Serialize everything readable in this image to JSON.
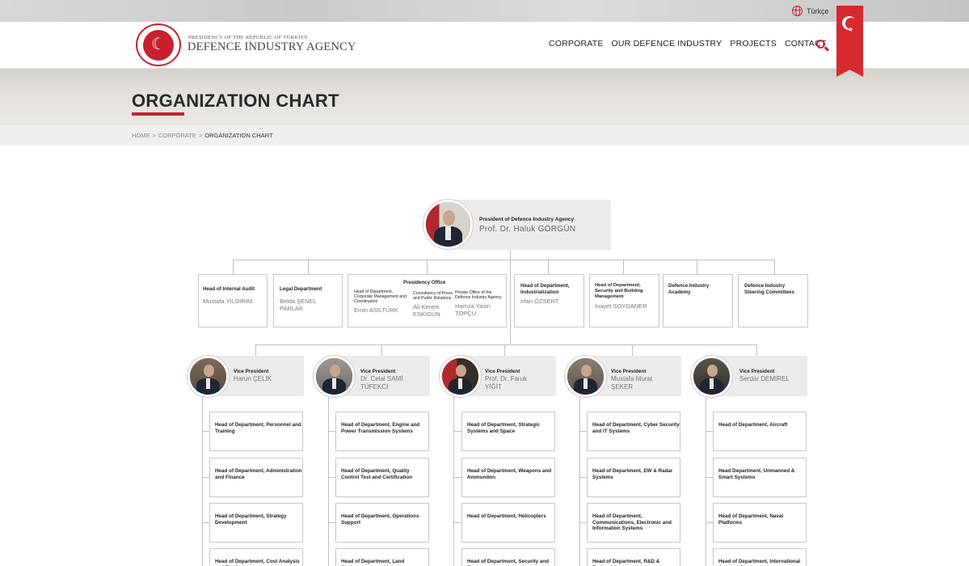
{
  "topbar": {
    "language": "Türkçe"
  },
  "logo": {
    "line1": "PRESIDENCY OF THE REPUBLIC OF TÜRKİYE",
    "line2": "DEFENCE INDUSTRY AGENCY"
  },
  "nav": [
    "CORPORATE",
    "OUR DEFENCE INDUSTRY",
    "PROJECTS",
    "CONTACT"
  ],
  "page": {
    "title": "ORGANIZATION CHART"
  },
  "breadcrumb": {
    "home": "HOME",
    "sep": ">",
    "corporate": "CORPORATE",
    "current": "ORGANIZATION CHART"
  },
  "colors": {
    "accent": "#c8202f",
    "box_grey": "#ebebeb"
  },
  "org": {
    "president": {
      "title": "President of Defence Industry Agency",
      "name": "Prof. Dr. Haluk GÖRGÜN"
    },
    "units": {
      "internal_audit": {
        "title": "Head of Internal Audit",
        "name": "Mustafa YILDIRIM"
      },
      "legal": {
        "title": "Legal Department",
        "name": "Belda ŞENEL PARLAK"
      },
      "presidency_office": {
        "title": "Presidency Office",
        "sub": [
          {
            "title": "Head of Department, Corporate Management and Coordination",
            "name": "Emin ASILTÜRK"
          },
          {
            "title": "Consultancy of Press and Public Relations",
            "name": "Ali Kerem ESKİGÜN"
          },
          {
            "title": "Private Office of the Defence Industry Agency",
            "name": "Hamza Yasin TOPÇU"
          }
        ]
      },
      "industrialization": {
        "title": "Head of Department, Industrialization",
        "name": "İrfan ÖZSERT"
      },
      "security": {
        "title": "Head of Department, Security and Building Management",
        "name": "İnayet SOYDANER"
      },
      "academy": {
        "title": "Defence Industry Academy"
      },
      "steering": {
        "title": "Defence Industry Steering Committees"
      }
    },
    "vice_presidents": [
      {
        "title": "Vice President",
        "name": "Harun ÇELİK",
        "depts": [
          "Head of Department, Personnel and Training",
          "Head of Department, Administration and Finance",
          "Head of Department, Strategy Development",
          "Head of Department, Cost Analysis and Planing"
        ]
      },
      {
        "title": "Vice President",
        "name": "Dr. Celal SAMİ TÜFEKCİ",
        "depts": [
          "Head of Department, Engine and Power Transmission Systems",
          "Head of Department, Quality Control Test and Certification",
          "Head of Department, Operations Support",
          "Head of Department, Land Platforms"
        ]
      },
      {
        "title": "Vice President",
        "name": "Prof. Dr. Faruk YİĞİT",
        "depts": [
          "Head of Department, Strategic Systems and Space",
          "Head of Department, Weapons and Ammuniton",
          "Head of Department, Helicopters",
          "Head of Department, Security and Equipment"
        ]
      },
      {
        "title": "Vice President",
        "name": "Mustafa Murat ŞEKER",
        "depts": [
          "Head of Department, Cyber Security and IT Systems",
          "Head of Department, EW & Radar Systems",
          "Head of Department, Communications, Electronic and Information Systems",
          "Head of Department, R&D & Technology"
        ]
      },
      {
        "title": "Vice President",
        "name": "Serdar DEMİREL",
        "depts": [
          "Head of Department, Aircraft",
          "Head Department, Unmanned & Smart Systems",
          "Head of Department, Naval Platforms",
          "Head of Department, International Cooperation"
        ]
      }
    ]
  }
}
